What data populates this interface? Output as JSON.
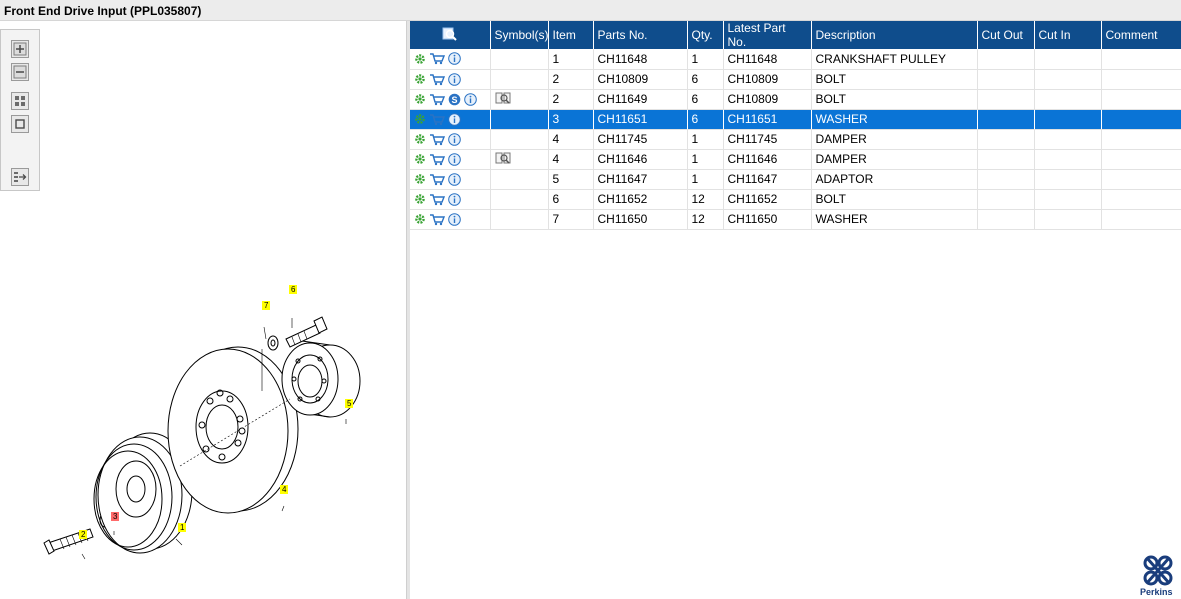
{
  "window": {
    "title": "Front End Drive Input (PPL035807)"
  },
  "toolbox": {
    "buttons": [
      "zoom-in",
      "zoom-out",
      "fit",
      "actual-size",
      "toggle-list"
    ]
  },
  "drawing": {
    "callouts": [
      {
        "id": "c7",
        "label": "7"
      },
      {
        "id": "c6",
        "label": "6"
      },
      {
        "id": "c5",
        "label": "5"
      },
      {
        "id": "c4",
        "label": "4"
      },
      {
        "id": "c3",
        "label": "3"
      },
      {
        "id": "c2",
        "label": "2"
      },
      {
        "id": "c1",
        "label": "1"
      }
    ]
  },
  "grid": {
    "headers": [
      "",
      "Symbol(s)",
      "Item",
      "Parts No.",
      "Qty.",
      "Latest Part No.",
      "Description",
      "Cut Out",
      "Cut In",
      "Comment"
    ],
    "rows": [
      {
        "item": "1",
        "part": "CH11648",
        "qty": "1",
        "latest": "CH11648",
        "desc": "CRANKSHAFT PULLEY",
        "cut_out": "",
        "cut_in": "",
        "comment": "",
        "s_badge": false,
        "symbol": false,
        "selected": false
      },
      {
        "item": "2",
        "part": "CH10809",
        "qty": "6",
        "latest": "CH10809",
        "desc": "BOLT",
        "cut_out": "",
        "cut_in": "",
        "comment": "",
        "s_badge": false,
        "symbol": false,
        "selected": false
      },
      {
        "item": "2",
        "part": "CH11649",
        "qty": "6",
        "latest": "CH10809",
        "desc": "BOLT",
        "cut_out": "",
        "cut_in": "",
        "comment": "",
        "s_badge": true,
        "symbol": true,
        "selected": false
      },
      {
        "item": "3",
        "part": "CH11651",
        "qty": "6",
        "latest": "CH11651",
        "desc": "WASHER",
        "cut_out": "",
        "cut_in": "",
        "comment": "",
        "s_badge": false,
        "symbol": false,
        "selected": true
      },
      {
        "item": "4",
        "part": "CH11745",
        "qty": "1",
        "latest": "CH11745",
        "desc": "DAMPER",
        "cut_out": "",
        "cut_in": "",
        "comment": "",
        "s_badge": false,
        "symbol": false,
        "selected": false
      },
      {
        "item": "4",
        "part": "CH11646",
        "qty": "1",
        "latest": "CH11646",
        "desc": "DAMPER",
        "cut_out": "",
        "cut_in": "",
        "comment": "",
        "s_badge": false,
        "symbol": true,
        "selected": false
      },
      {
        "item": "5",
        "part": "CH11647",
        "qty": "1",
        "latest": "CH11647",
        "desc": "ADAPTOR",
        "cut_out": "",
        "cut_in": "",
        "comment": "",
        "s_badge": false,
        "symbol": false,
        "selected": false
      },
      {
        "item": "6",
        "part": "CH11652",
        "qty": "12",
        "latest": "CH11652",
        "desc": "BOLT",
        "cut_out": "",
        "cut_in": "",
        "comment": "",
        "s_badge": false,
        "symbol": false,
        "selected": false
      },
      {
        "item": "7",
        "part": "CH11650",
        "qty": "12",
        "latest": "CH11650",
        "desc": "WASHER",
        "cut_out": "",
        "cut_in": "",
        "comment": "",
        "s_badge": false,
        "symbol": false,
        "selected": false
      }
    ]
  },
  "icons": {
    "gear": "gear-icon",
    "cart": "cart-icon",
    "info": "info-icon",
    "s_badge": "s-badge-icon",
    "symbol": "magnifier-book-icon",
    "header_search": "search-icon"
  },
  "colors": {
    "header_bg": "#0f4d8c",
    "selected_row": "#0a74d6",
    "gear": "#3aa335",
    "info": "#2b73c4",
    "callout": "#ffff00",
    "callout_selected": "#ff6a6a"
  },
  "logo": {
    "text": "Perkins"
  }
}
